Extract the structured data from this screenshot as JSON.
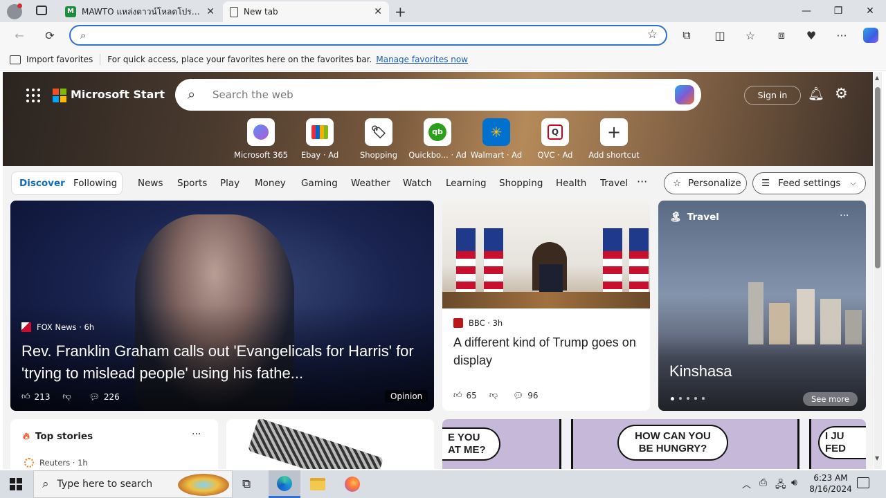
{
  "browser": {
    "tabs": [
      {
        "label": "MAWTO แหล่งดาวน์โหลดโปรแกรมฟรี",
        "active": false
      },
      {
        "label": "New tab",
        "active": true
      }
    ],
    "address": {
      "value": "",
      "placeholder": ""
    },
    "window_controls": [
      "minimize-icon",
      "restore-icon",
      "close-icon"
    ]
  },
  "favorites_bar": {
    "import_label": "Import favorites",
    "message": "For quick access, place your favorites here on the favorites bar.",
    "manage_link": "Manage favorites now"
  },
  "start": {
    "brand": "Microsoft Start",
    "search_placeholder": "Search the web",
    "sign_in": "Sign in",
    "shortcuts": [
      {
        "label": "Microsoft 365",
        "color": "#7b5cd6"
      },
      {
        "label": "Ebay · Ad",
        "color": "#e53238"
      },
      {
        "label": "Shopping",
        "color": "#444444"
      },
      {
        "label": "Quickbo... · Ad",
        "color": "#2ca01c"
      },
      {
        "label": "Walmart · Ad",
        "color": "#0071ce"
      },
      {
        "label": "QVC · Ad",
        "color": "#d0021b"
      },
      {
        "label": "Add shortcut",
        "color": "#ffffff"
      }
    ],
    "feed_tabs": [
      "Discover",
      "Following"
    ],
    "categories": [
      "News",
      "Sports",
      "Play",
      "Money",
      "Gaming",
      "Weather",
      "Watch",
      "Learning",
      "Shopping",
      "Health",
      "Travel"
    ],
    "personalize": "Personalize",
    "feed_settings": "Feed settings"
  },
  "cards": {
    "main": {
      "source": "FOX News · 6h",
      "headline": "Rev. Franklin Graham calls out 'Evangelicals for Harris' for 'trying to mislead people' using his fathe...",
      "likes": "213",
      "comments": "226",
      "tag": "Opinion"
    },
    "bbc": {
      "source": "BBC · 3h",
      "headline": "A different kind of Trump goes on display",
      "likes": "65",
      "comments": "96"
    },
    "travel": {
      "label": "Travel",
      "place": "Kinshasa",
      "see_more": "See more"
    },
    "top_stories": {
      "title": "Top stories",
      "first_source": "Reuters · 1h"
    },
    "comic": {
      "bubble1": "E YOU AT ME?",
      "bubble2": "HOW CAN YOU BE HUNGRY?",
      "bubble3": "I JU FED"
    }
  },
  "taskbar": {
    "search_placeholder": "Type here to search",
    "time": "6:23 AM",
    "date": "8/16/2024"
  }
}
